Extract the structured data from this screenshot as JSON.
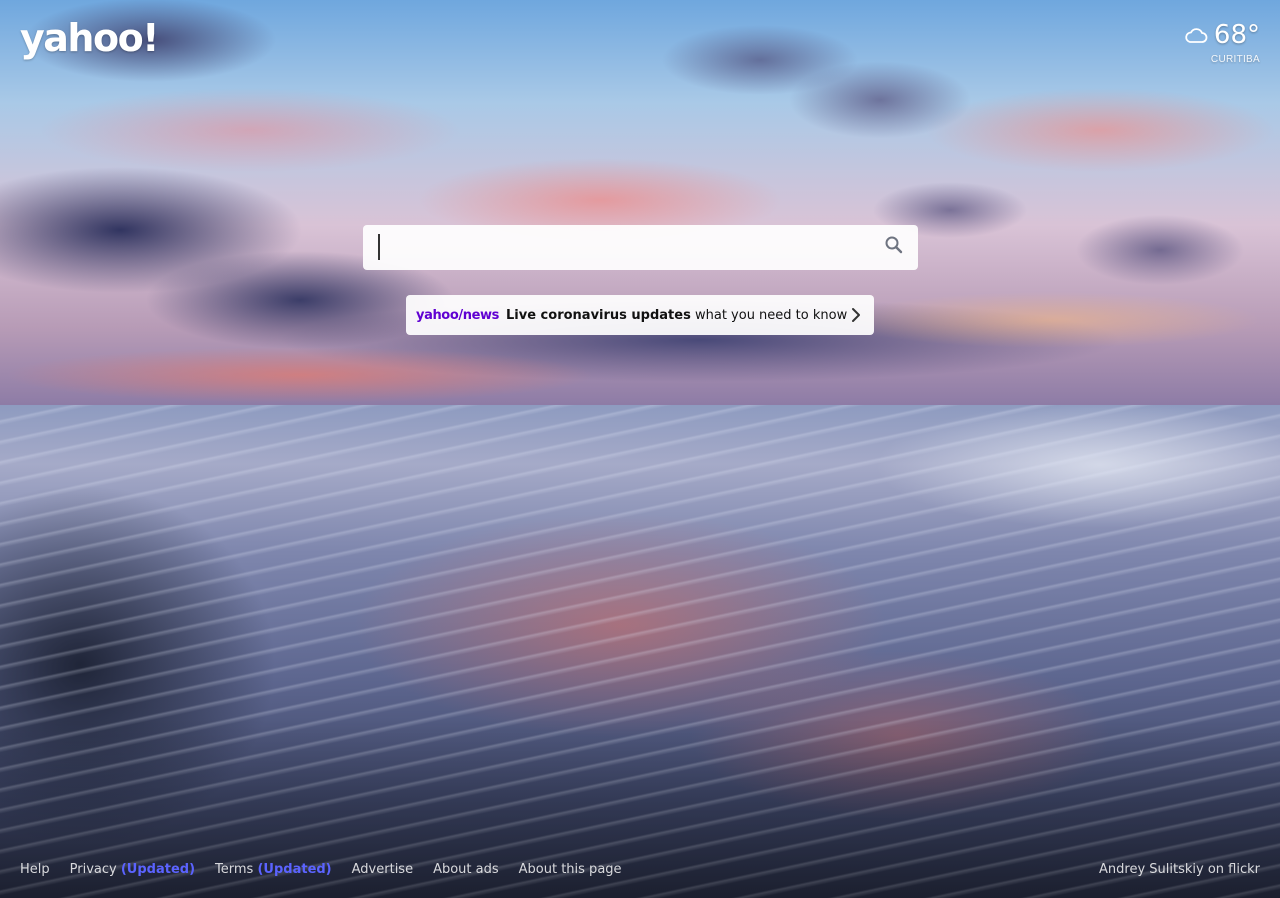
{
  "brand": {
    "logo_text": "yahoo!"
  },
  "weather": {
    "temperature": "68°",
    "city": "CURITIBA",
    "icon": "cloud-icon"
  },
  "search": {
    "value": "",
    "placeholder": "",
    "button_icon": "search-icon"
  },
  "news": {
    "source_logo": "yahoo/news",
    "headline_bold": "Live coronavirus updates",
    "headline_rest": " what you need to know",
    "chevron_icon": "chevron-right-icon",
    "accent_color": "#6001d2"
  },
  "footer": {
    "help": "Help",
    "privacy": "Privacy",
    "privacy_updated": "(Updated)",
    "terms": "Terms",
    "terms_updated": "(Updated)",
    "advertise": "Advertise",
    "about_ads": "About ads",
    "about_page": "About this page",
    "credit": "Andrey Sulitskiy on flickr",
    "updated_color": "#5b63ff"
  }
}
